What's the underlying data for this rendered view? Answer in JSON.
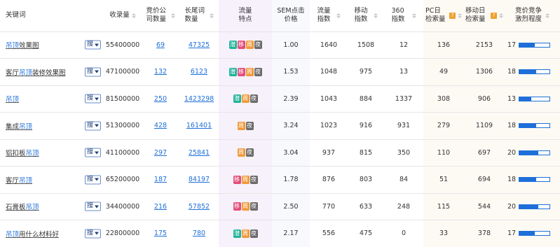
{
  "headers": {
    "keyword": "关键词",
    "volume": "收录量",
    "bid_companies": "竞价公司数量",
    "longtail": "长尾词数量",
    "traits": "流量特点",
    "sem": "SEM点击价格",
    "traffic": "流量指数",
    "mobile": "移动指数",
    "idx360": "360指数",
    "pc_daily": "PC日检索量",
    "mobile_daily": "移动日检索量",
    "competition": "竞价竞争激烈程度"
  },
  "search_button_label": "搜",
  "colors": {
    "tag_qian": "#22b39a",
    "tag_yi": "#e24f7a",
    "tag_zhou": "#f09a3a",
    "tag_ye": "#6b6b6b",
    "link": "#1e6fd9",
    "bar": "#1e6fd9",
    "help_badge": "#f0a030"
  },
  "tag_labels": {
    "qian": "潜",
    "yi": "移",
    "zhou": "周",
    "ye": "夜"
  },
  "help_icon": "?",
  "rows": [
    {
      "kw_pre": "",
      "kw_hl": "吊顶",
      "kw_post": "效果图",
      "volume": "55400000",
      "bid_companies": "69",
      "longtail": "47325",
      "tags": [
        "qian",
        "yi",
        "zhou",
        "ye"
      ],
      "sem": "1.00",
      "traffic": "1640",
      "mobile": "1508",
      "idx360": "12",
      "pc_daily": "136",
      "mobile_daily": "2153",
      "competition": "17",
      "competition_level": 0.52
    },
    {
      "kw_pre": "客厅",
      "kw_hl": "吊顶",
      "kw_post": "装修效果图",
      "volume": "47100000",
      "bid_companies": "132",
      "longtail": "6123",
      "tags": [
        "qian",
        "yi",
        "zhou",
        "ye"
      ],
      "sem": "1.53",
      "traffic": "1048",
      "mobile": "975",
      "idx360": "13",
      "pc_daily": "49",
      "mobile_daily": "1306",
      "competition": "18",
      "competition_level": 0.55
    },
    {
      "kw_pre": "",
      "kw_hl": "吊顶",
      "kw_post": "",
      "volume": "81500000",
      "bid_companies": "250",
      "longtail": "1423298",
      "tags": [
        "qian",
        "zhou",
        "ye"
      ],
      "sem": "2.39",
      "traffic": "1043",
      "mobile": "884",
      "idx360": "1337",
      "pc_daily": "308",
      "mobile_daily": "906",
      "competition": "13",
      "competition_level": 0.4
    },
    {
      "kw_pre": "集成",
      "kw_hl": "吊顶",
      "kw_post": "",
      "volume": "51300000",
      "bid_companies": "428",
      "longtail": "161401",
      "tags": [
        "zhou",
        "ye"
      ],
      "sem": "3.24",
      "traffic": "1023",
      "mobile": "916",
      "idx360": "931",
      "pc_daily": "279",
      "mobile_daily": "1109",
      "competition": "18",
      "competition_level": 0.55
    },
    {
      "kw_pre": "铝扣板",
      "kw_hl": "吊顶",
      "kw_post": "",
      "volume": "41100000",
      "bid_companies": "297",
      "longtail": "25841",
      "tags": [
        "zhou",
        "ye"
      ],
      "sem": "3.04",
      "traffic": "937",
      "mobile": "815",
      "idx360": "350",
      "pc_daily": "110",
      "mobile_daily": "697",
      "competition": "20",
      "competition_level": 0.62
    },
    {
      "kw_pre": "客厅",
      "kw_hl": "吊顶",
      "kw_post": "",
      "volume": "65200000",
      "bid_companies": "187",
      "longtail": "84197",
      "tags": [
        "yi",
        "zhou",
        "ye"
      ],
      "sem": "1.78",
      "traffic": "876",
      "mobile": "803",
      "idx360": "84",
      "pc_daily": "51",
      "mobile_daily": "694",
      "competition": "18",
      "competition_level": 0.55
    },
    {
      "kw_pre": "石膏板",
      "kw_hl": "吊顶",
      "kw_post": "",
      "volume": "34400000",
      "bid_companies": "216",
      "longtail": "57852",
      "tags": [
        "yi",
        "zhou",
        "ye"
      ],
      "sem": "2.50",
      "traffic": "770",
      "mobile": "633",
      "idx360": "248",
      "pc_daily": "115",
      "mobile_daily": "544",
      "competition": "20",
      "competition_level": 0.62
    },
    {
      "kw_pre": "",
      "kw_hl": "吊顶",
      "kw_post": "用什么材料好",
      "volume": "22800000",
      "bid_companies": "175",
      "longtail": "780",
      "tags": [
        "qian",
        "zhou",
        "ye"
      ],
      "sem": "2.17",
      "traffic": "556",
      "mobile": "475",
      "idx360": "0",
      "pc_daily": "33",
      "mobile_daily": "378",
      "competition": "17",
      "competition_level": 0.52
    }
  ]
}
